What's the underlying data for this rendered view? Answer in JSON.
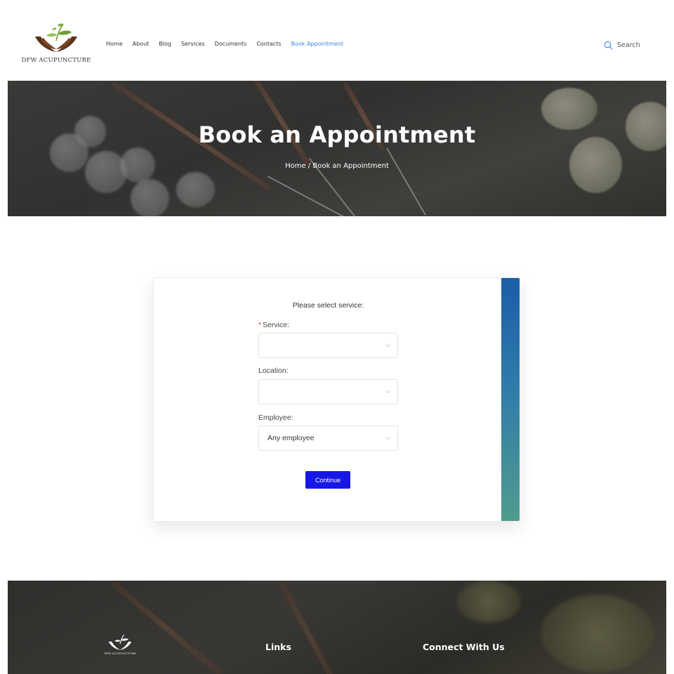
{
  "header": {
    "logo_text": "DFW ACUPUNCTURE",
    "nav": [
      {
        "label": "Home"
      },
      {
        "label": "About"
      },
      {
        "label": "Blog"
      },
      {
        "label": "Services"
      },
      {
        "label": "Documents"
      },
      {
        "label": "Contacts"
      },
      {
        "label": "Book Appointment",
        "active": true
      }
    ],
    "search_label": "Search"
  },
  "hero": {
    "title": "Book an Appointment",
    "breadcrumb": "Home / Book an Appointment"
  },
  "booking": {
    "heading": "Please select service:",
    "service": {
      "required_mark": "*",
      "label": "Service:",
      "value": ""
    },
    "location": {
      "label": "Location:",
      "value": ""
    },
    "employee": {
      "label": "Employee:",
      "value": "Any employee"
    },
    "continue_label": "Continue"
  },
  "footer": {
    "logo_text": "DFW ACUPUNCTURE",
    "links_heading": "Links",
    "connect_heading": "Connect With Us"
  },
  "colors": {
    "accent_link": "#3a86d8",
    "continue_button": "#1717e5",
    "side_gradient_top": "#1a5ea8",
    "side_gradient_bottom": "#4f9c8e",
    "required": "#e03d3d"
  },
  "icons": {
    "search": "search-icon",
    "dropdown": "chevron-down-icon",
    "logo": "leaf-hands-logo-icon"
  }
}
